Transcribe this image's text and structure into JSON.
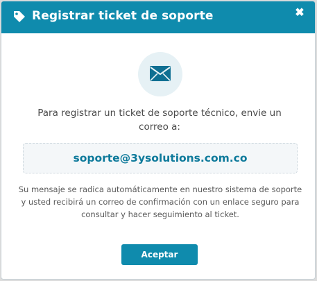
{
  "modal": {
    "title": "Registrar ticket de soporte",
    "close_label": "✖",
    "header_icon": "tag-icon",
    "mail_icon": "envelope-icon",
    "intro": "Para registrar un ticket de soporte técnico, envie un correo a:",
    "email": "soporte@3ysolutions.com.co",
    "info": "Su mensaje se radica automáticamente en nuestro sistema de soporte y usted recibirá un correo de confirmación con un enlace seguro para consultar y hacer seguimiento al ticket.",
    "accept_label": "Aceptar"
  },
  "colors": {
    "header_bg": "#0f8bad",
    "email_text": "#0e7a9b",
    "icon_circle": "#e6f1f5"
  }
}
